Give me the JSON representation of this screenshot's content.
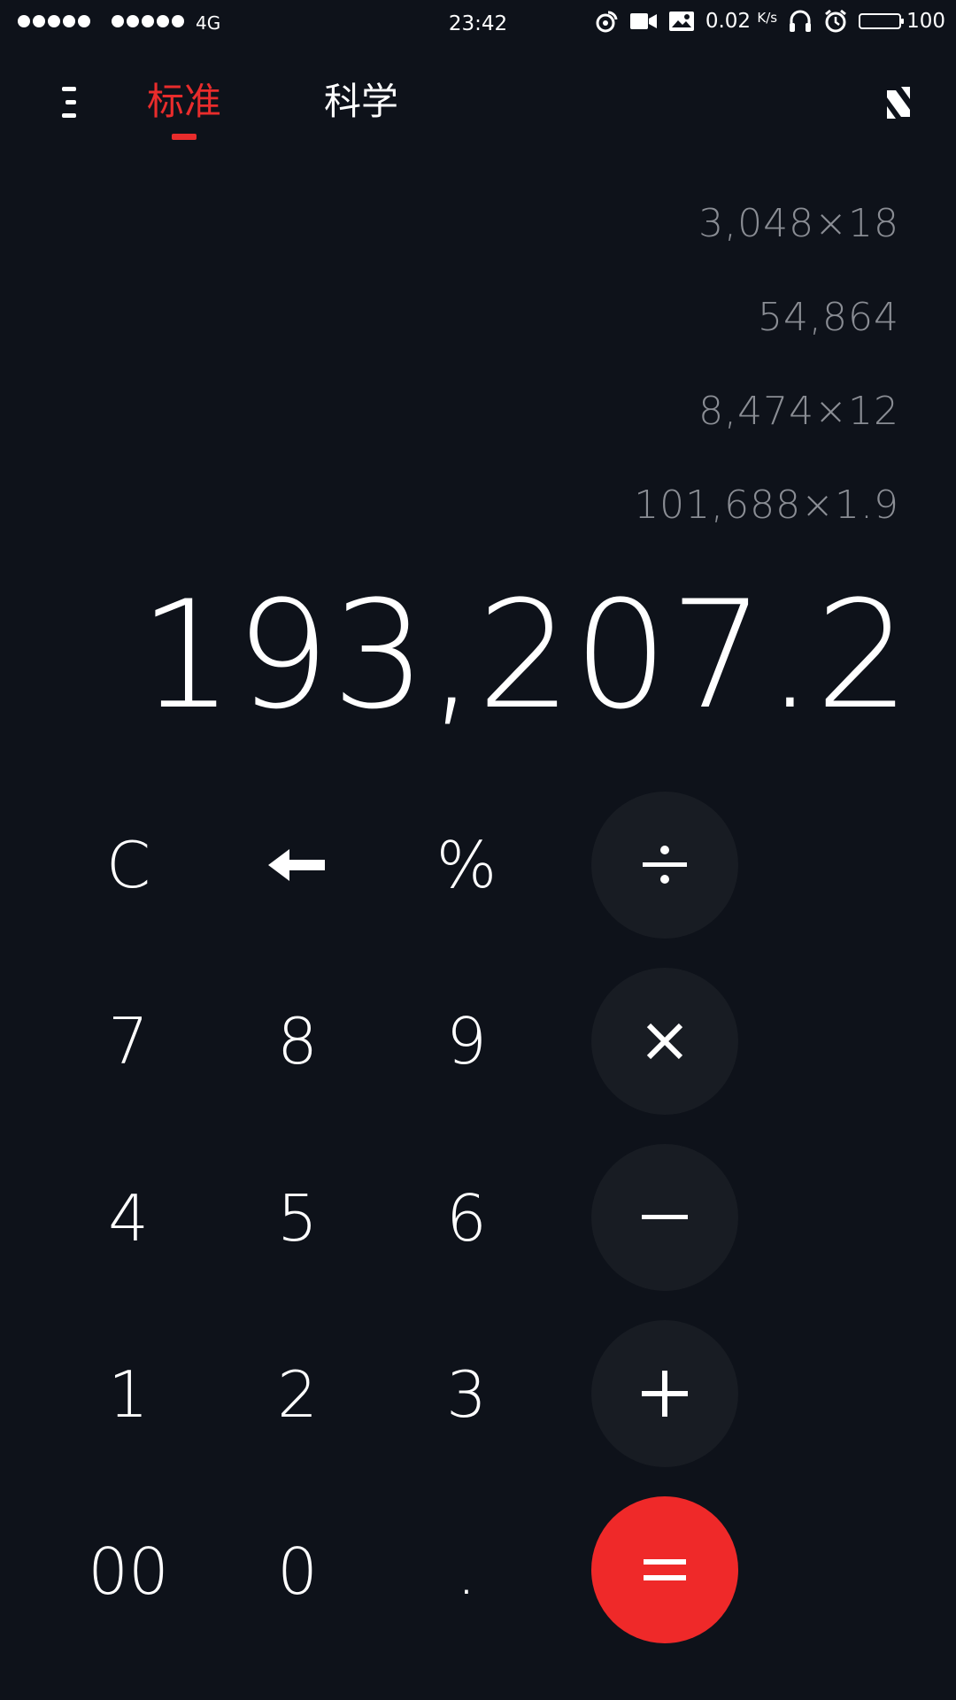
{
  "status_bar": {
    "network": "4G",
    "time": "23:42",
    "speed": "0.02",
    "speed_unit": "K/s",
    "battery": "100",
    "battery_level": 1.0
  },
  "tabs": {
    "standard": "标准",
    "science": "科学"
  },
  "history": [
    {
      "a": "3,048",
      "op": "×",
      "b": "18"
    },
    {
      "a": "54,864",
      "op": "",
      "b": ""
    },
    {
      "a": "8,474",
      "op": "×",
      "b": "12"
    },
    {
      "a": "101,688",
      "op": "×",
      "b": "1.9"
    }
  ],
  "result": "193,207.2",
  "keys": {
    "clear": "C",
    "percent": "%",
    "k7": "7",
    "k8": "8",
    "k9": "9",
    "k4": "4",
    "k5": "5",
    "k6": "6",
    "k1": "1",
    "k2": "2",
    "k3": "3",
    "k00": "00",
    "k0": "0",
    "dot": "."
  },
  "colors": {
    "accent": "#e92c2c",
    "background": "#0e121a",
    "operator_bg": "#181c23",
    "history_text": "#8a8d94"
  }
}
